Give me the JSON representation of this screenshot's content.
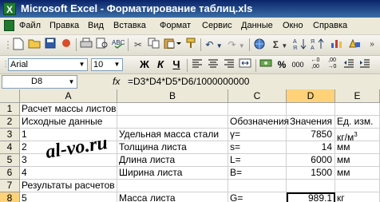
{
  "window": {
    "title": "Microsoft Excel - Форматирование таблиц.xls"
  },
  "menu": [
    "Файл",
    "Правка",
    "Вид",
    "Вставка",
    "Формат",
    "Сервис",
    "Данные",
    "Окно",
    "Справка"
  ],
  "font_toolbar": {
    "font_name": "Arial",
    "font_size": "10",
    "bold": "Ж",
    "italic": "К",
    "underline": "Ч"
  },
  "formula_bar": {
    "cell_ref": "D8",
    "fx": "fx",
    "formula": "=D3*D4*D5*D6/1000000000"
  },
  "columns": [
    "A",
    "B",
    "C",
    "D",
    "E"
  ],
  "rows": [
    {
      "n": "1",
      "A": "Расчет массы листов",
      "B": "",
      "C": "",
      "D": "",
      "E": ""
    },
    {
      "n": "2",
      "A": "Исходные данные",
      "B": "",
      "C": "Обозначения",
      "D": "Значения",
      "E": "Ед. изм."
    },
    {
      "n": "3",
      "A": "1",
      "B": "Удельная масса стали",
      "C": "γ=",
      "D": "7850",
      "E": "кг/м",
      "E_sup": "3"
    },
    {
      "n": "4",
      "A": "2",
      "B": "Толщина листа",
      "C": "s=",
      "D": "14",
      "E": "мм"
    },
    {
      "n": "5",
      "A": "3",
      "B": "Длина листа",
      "C": "L=",
      "D": "6000",
      "E": "мм"
    },
    {
      "n": "6",
      "A": "4",
      "B": "Ширина листа",
      "C": "B=",
      "D": "1500",
      "E": "мм"
    },
    {
      "n": "7",
      "A": "Результаты расчетов",
      "B": "",
      "C": "",
      "D": "",
      "E": ""
    },
    {
      "n": "8",
      "A": "5",
      "B": "Масса листа",
      "C": "G=",
      "D": "989.1",
      "E": "кг"
    }
  ],
  "watermark": "al-vo.ru"
}
